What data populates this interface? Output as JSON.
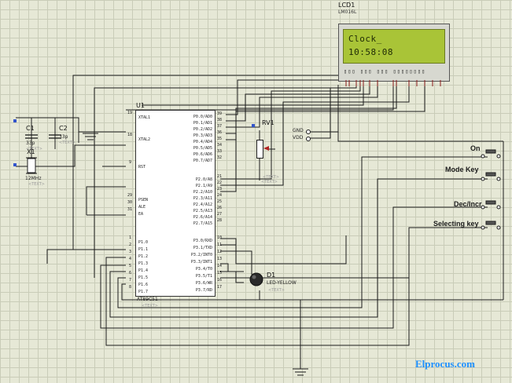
{
  "lcd": {
    "ref": "LCD1",
    "part": "LM016L",
    "line1": "Clock_",
    "line2": "10:58:08",
    "text_tag": "<TEXT>"
  },
  "mcu": {
    "ref": "U1",
    "part": "AT89C51",
    "text_tag": "<TEXT>",
    "left_pins": [
      {
        "num": "19",
        "name": "XTAL1"
      },
      {
        "num": "18",
        "name": "XTAL2"
      },
      {
        "num": "9",
        "name": "RST"
      },
      {
        "num": "29",
        "name": "PSEN"
      },
      {
        "num": "30",
        "name": "ALE"
      },
      {
        "num": "31",
        "name": "EA"
      },
      {
        "num": "1",
        "name": "P1.0"
      },
      {
        "num": "2",
        "name": "P1.1"
      },
      {
        "num": "3",
        "name": "P1.2"
      },
      {
        "num": "4",
        "name": "P1.3"
      },
      {
        "num": "5",
        "name": "P1.4"
      },
      {
        "num": "6",
        "name": "P1.5"
      },
      {
        "num": "7",
        "name": "P1.6"
      },
      {
        "num": "8",
        "name": "P1.7"
      }
    ],
    "right_pins": [
      {
        "num": "39",
        "name": "P0.0/AD0"
      },
      {
        "num": "38",
        "name": "P0.1/AD1"
      },
      {
        "num": "37",
        "name": "P0.2/AD2"
      },
      {
        "num": "36",
        "name": "P0.3/AD3"
      },
      {
        "num": "35",
        "name": "P0.4/AD4"
      },
      {
        "num": "34",
        "name": "P0.5/AD5"
      },
      {
        "num": "33",
        "name": "P0.6/AD6"
      },
      {
        "num": "32",
        "name": "P0.7/AD7"
      },
      {
        "num": "21",
        "name": "P2.0/A8"
      },
      {
        "num": "22",
        "name": "P2.1/A9"
      },
      {
        "num": "23",
        "name": "P2.2/A10"
      },
      {
        "num": "24",
        "name": "P2.3/A11"
      },
      {
        "num": "25",
        "name": "P2.4/A12"
      },
      {
        "num": "26",
        "name": "P2.5/A13"
      },
      {
        "num": "27",
        "name": "P2.6/A14"
      },
      {
        "num": "28",
        "name": "P2.7/A15"
      },
      {
        "num": "10",
        "name": "P3.0/RXD"
      },
      {
        "num": "11",
        "name": "P3.1/TXD"
      },
      {
        "num": "12",
        "name": "P3.2/INT0"
      },
      {
        "num": "13",
        "name": "P3.3/INT1"
      },
      {
        "num": "14",
        "name": "P3.4/T0"
      },
      {
        "num": "15",
        "name": "P3.5/T1"
      },
      {
        "num": "16",
        "name": "P3.6/WR"
      },
      {
        "num": "17",
        "name": "P3.7/RD"
      }
    ]
  },
  "components": {
    "c1": {
      "ref": "C1",
      "value": "33p",
      "tag": "<TEXT>"
    },
    "c2": {
      "ref": "C2",
      "value": "33p",
      "tag": "<TEXT>"
    },
    "x1": {
      "ref": "X1",
      "value": "12MHz",
      "tag": "<TEXT>"
    },
    "rv1": {
      "ref": "RV1",
      "tag": "<TEXT>"
    },
    "d1": {
      "ref": "D1",
      "value": "LED-YELLOW",
      "tag": "<TEXT>"
    },
    "gnd": "GND",
    "vdd": "VDD"
  },
  "keys": [
    {
      "label": "On"
    },
    {
      "label": "Mode Key"
    },
    {
      "label": "Dec/Incr"
    },
    {
      "label": "Selecting key"
    }
  ],
  "brand": "Elprocus.com",
  "colors": {
    "lcd_screen": "#a9c437",
    "lcd_body": "#d7d8d0",
    "chip_body": "#ffffff",
    "wire": "#1c1c1c",
    "pin": "#8b1a1a",
    "led": "#2b2b2b",
    "brand": "#1e90ff"
  }
}
